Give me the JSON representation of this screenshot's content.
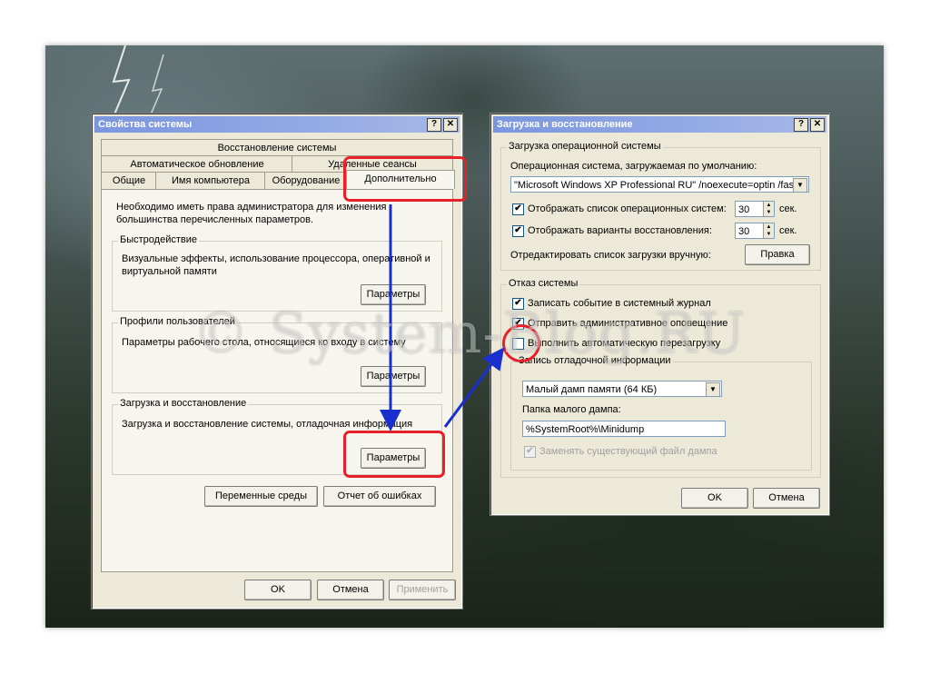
{
  "sysprops": {
    "title": "Свойства системы",
    "tabs_row1": [
      "Восстановление системы"
    ],
    "tabs_row2": [
      "Автоматическое обновление",
      "Удаленные сеансы"
    ],
    "tabs_row3": [
      "Общие",
      "Имя компьютера",
      "Оборудование",
      "Дополнительно"
    ],
    "admin_note": "Необходимо иметь права администратора для изменения большинства перечисленных параметров.",
    "perf": {
      "title": "Быстродействие",
      "text": "Визуальные эффекты, использование процессора, оперативной и виртуальной памяти",
      "button": "Параметры"
    },
    "profiles": {
      "title": "Профили пользователей",
      "text": "Параметры рабочего стола, относящиеся ко входу в систему",
      "button": "Параметры"
    },
    "startup": {
      "title": "Загрузка и восстановление",
      "text": "Загрузка и восстановление системы, отладочная информация",
      "button": "Параметры"
    },
    "env_button": "Переменные среды",
    "error_button": "Отчет об ошибках",
    "ok": "OK",
    "cancel": "Отмена",
    "apply": "Применить"
  },
  "startup_dialog": {
    "title": "Загрузка и восстановление",
    "os_group": "Загрузка операционной системы",
    "default_os_label": "Операционная система, загружаемая по умолчанию:",
    "default_os_value": "\"Microsoft Windows XP Professional RU\" /noexecute=optin /fastd",
    "show_list_label": "Отображать список операционных систем:",
    "show_list_value": "30",
    "show_recovery_label": "Отображать варианты восстановления:",
    "show_recovery_value": "30",
    "sec": "сек.",
    "edit_label": "Отредактировать список загрузки вручную:",
    "edit_button": "Правка",
    "failure_group": "Отказ системы",
    "write_event": "Записать событие в системный журнал",
    "send_alert": "Отправить административное оповещение",
    "auto_restart": "Выполнить автоматическую перезагрузку",
    "debug_group": "Запись отладочной информации",
    "dump_type": "Малый дамп памяти (64 КБ)",
    "dump_folder_label": "Папка малого дампа:",
    "dump_folder_value": "%SystemRoot%\\Minidump",
    "overwrite": "Заменять существующий файл дампа",
    "ok": "OK",
    "cancel": "Отмена"
  },
  "checks": {
    "show_list": "✔",
    "show_recovery": "✔",
    "write_event": "✔",
    "send_alert": "✔",
    "auto_restart": "",
    "overwrite": "✔"
  },
  "title_buttons": {
    "help": "?",
    "close": "✕"
  },
  "watermark": "© System-Blog.RU",
  "colors": {
    "highlight": "#e8202a",
    "arrow": "#1a2fd0"
  }
}
